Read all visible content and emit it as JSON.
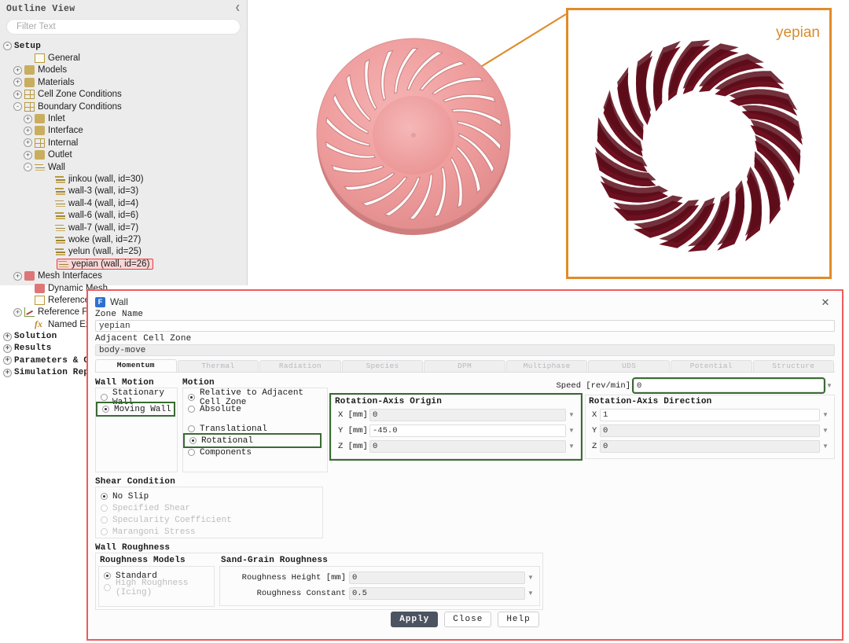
{
  "outline": {
    "header_title": "Outline View",
    "collapse_icon": "chevron-left-icon",
    "filter_placeholder": "Filter Text",
    "tree": [
      {
        "label": "Setup",
        "depth": 0,
        "exp": "-",
        "icon": "none",
        "bold": true
      },
      {
        "label": "General",
        "depth": 2,
        "exp": "",
        "icon": "doc-icon"
      },
      {
        "label": "Models",
        "depth": 1,
        "exp": "+",
        "icon": "models-icon"
      },
      {
        "label": "Materials",
        "depth": 1,
        "exp": "+",
        "icon": "materials-icon"
      },
      {
        "label": "Cell Zone Conditions",
        "depth": 1,
        "exp": "+",
        "icon": "grid-icon"
      },
      {
        "label": "Boundary Conditions",
        "depth": 1,
        "exp": "-",
        "icon": "grid-icon"
      },
      {
        "label": "Inlet",
        "depth": 2,
        "exp": "+",
        "icon": "inlet-icon"
      },
      {
        "label": "Interface",
        "depth": 2,
        "exp": "+",
        "icon": "interface-icon"
      },
      {
        "label": "Internal",
        "depth": 2,
        "exp": "+",
        "icon": "grid-icon"
      },
      {
        "label": "Outlet",
        "depth": 2,
        "exp": "+",
        "icon": "outlet-icon"
      },
      {
        "label": "Wall",
        "depth": 2,
        "exp": "-",
        "icon": "wall-icon"
      },
      {
        "label": "jinkou (wall, id=30)",
        "depth": 4,
        "exp": "",
        "icon": "wall-icon"
      },
      {
        "label": "wall-3 (wall, id=3)",
        "depth": 4,
        "exp": "",
        "icon": "wall-icon"
      },
      {
        "label": "wall-4 (wall, id=4)",
        "depth": 4,
        "exp": "",
        "icon": "wall-icon"
      },
      {
        "label": "wall-6 (wall, id=6)",
        "depth": 4,
        "exp": "",
        "icon": "wall-icon"
      },
      {
        "label": "wall-7 (wall, id=7)",
        "depth": 4,
        "exp": "",
        "icon": "wall-icon"
      },
      {
        "label": "woke (wall, id=27)",
        "depth": 4,
        "exp": "",
        "icon": "wall-icon"
      },
      {
        "label": "yelun (wall, id=25)",
        "depth": 4,
        "exp": "",
        "icon": "wall-icon"
      },
      {
        "label": "yepian (wall, id=26)",
        "depth": 4,
        "exp": "",
        "icon": "wall-icon",
        "selected": true
      },
      {
        "label": "Mesh Interfaces",
        "depth": 1,
        "exp": "+",
        "icon": "mesh-icon"
      },
      {
        "label": "Dynamic Mesh",
        "depth": 2,
        "exp": "",
        "icon": "dynmesh-icon"
      },
      {
        "label": "Reference Values",
        "depth": 2,
        "exp": "",
        "icon": "doc-icon"
      },
      {
        "label": "Reference Frames",
        "depth": 1,
        "exp": "+",
        "icon": "chart-icon"
      },
      {
        "label": "Named Expressions",
        "depth": 2,
        "exp": "",
        "icon": "fx-icon"
      },
      {
        "label": "Solution",
        "depth": 0,
        "exp": "+",
        "icon": "none",
        "bold": true
      },
      {
        "label": "Results",
        "depth": 0,
        "exp": "+",
        "icon": "none",
        "bold": true
      },
      {
        "label": "Parameters & Customization",
        "depth": 0,
        "exp": "+",
        "icon": "none",
        "bold": true
      },
      {
        "label": "Simulation Reports",
        "depth": 0,
        "exp": "+",
        "icon": "none",
        "bold": true
      }
    ]
  },
  "graphics": {
    "inset_label": "yepian",
    "inset_border_color": "#e08b2a",
    "leader_color": "#e08b2a",
    "impeller_body_color": "#ef9d9d",
    "blade_color": "#6d1020"
  },
  "dialog": {
    "title": "Wall",
    "app_icon": "fluent-icon",
    "close_icon": "close-icon",
    "zone_name_label": "Zone Name",
    "zone_name_value": "yepian",
    "adjacent_cell_zone_label": "Adjacent Cell Zone",
    "adjacent_cell_zone_value": "body-move",
    "tabs": [
      {
        "label": "Momentum",
        "active": true
      },
      {
        "label": "Thermal",
        "active": false
      },
      {
        "label": "Radiation",
        "active": false
      },
      {
        "label": "Species",
        "active": false
      },
      {
        "label": "DPM",
        "active": false
      },
      {
        "label": "Multiphase",
        "active": false
      },
      {
        "label": "UDS",
        "active": false
      },
      {
        "label": "Potential",
        "active": false
      },
      {
        "label": "Structure",
        "active": false
      }
    ],
    "wall_motion": {
      "title": "Wall Motion",
      "options": [
        {
          "label": "Stationary Wall",
          "selected": false,
          "highlight": false
        },
        {
          "label": "Moving Wall",
          "selected": true,
          "highlight": true
        }
      ]
    },
    "motion": {
      "title": "Motion",
      "options": [
        {
          "label": "Relative to Adjacent Cell Zone",
          "selected": true,
          "highlight": false
        },
        {
          "label": "Absolute",
          "selected": false,
          "highlight": false
        },
        {
          "label": "Translational",
          "selected": false,
          "highlight": false,
          "gap": true
        },
        {
          "label": "Rotational",
          "selected": true,
          "highlight": true
        },
        {
          "label": "Components",
          "selected": false,
          "highlight": false
        }
      ]
    },
    "speed": {
      "label": "Speed [rev/min]",
      "value": "0",
      "highlight": true
    },
    "rotation_axis_origin": {
      "title": "Rotation-Axis Origin",
      "highlight": true,
      "fields": [
        {
          "label": "X [mm]",
          "value": "0"
        },
        {
          "label": "Y [mm]",
          "value": "-45.0"
        },
        {
          "label": "Z [mm]",
          "value": "0"
        }
      ]
    },
    "rotation_axis_direction": {
      "title": "Rotation-Axis Direction",
      "highlight": false,
      "fields": [
        {
          "label": "X",
          "value": "1"
        },
        {
          "label": "Y",
          "value": "0"
        },
        {
          "label": "Z",
          "value": "0"
        }
      ]
    },
    "shear_condition": {
      "title": "Shear Condition",
      "options": [
        {
          "label": "No Slip",
          "selected": true,
          "dim": false
        },
        {
          "label": "Specified Shear",
          "selected": false,
          "dim": true
        },
        {
          "label": "Specularity Coefficient",
          "selected": false,
          "dim": true
        },
        {
          "label": "Marangoni Stress",
          "selected": false,
          "dim": true
        }
      ]
    },
    "wall_roughness": {
      "title": "Wall Roughness",
      "models_title": "Roughness Models",
      "models": [
        {
          "label": "Standard",
          "selected": true,
          "dim": false
        },
        {
          "label": "High Roughness (Icing)",
          "selected": false,
          "dim": true
        }
      ],
      "sand_grain_title": "Sand-Grain Roughness",
      "fields": [
        {
          "label": "Roughness Height [mm]",
          "value": "0"
        },
        {
          "label": "Roughness Constant",
          "value": "0.5"
        }
      ]
    },
    "buttons": [
      {
        "label": "Apply",
        "primary": true
      },
      {
        "label": "Close",
        "primary": false
      },
      {
        "label": "Help",
        "primary": false
      }
    ],
    "highlight_color": "#3a6b33",
    "frame_color": "#ef5b5b"
  }
}
